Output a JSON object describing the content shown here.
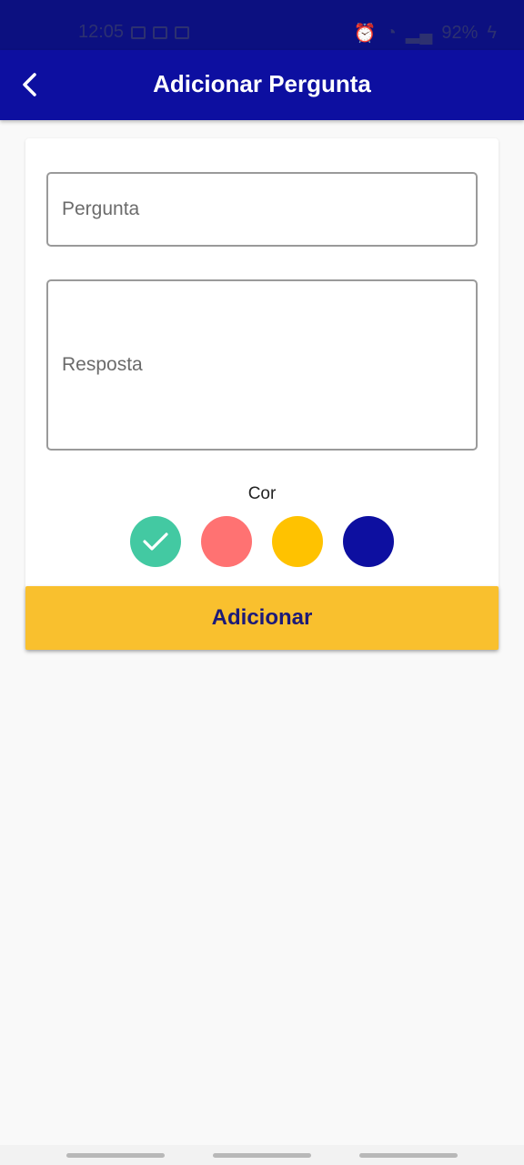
{
  "status_bar": {
    "time": "12:05",
    "battery": "92%"
  },
  "app_bar": {
    "title": "Adicionar Pergunta",
    "back_icon": "chevron-left-icon"
  },
  "form": {
    "question_placeholder": "Pergunta",
    "answer_placeholder": "Resposta",
    "color_label": "Cor",
    "colors": [
      {
        "name": "green",
        "hex": "#43c9a2",
        "selected": true
      },
      {
        "name": "red",
        "hex": "#ff7272",
        "selected": false
      },
      {
        "name": "yellow",
        "hex": "#ffc200",
        "selected": false
      },
      {
        "name": "blue",
        "hex": "#0d0fa0",
        "selected": false
      }
    ],
    "submit_label": "Adicionar"
  },
  "theme": {
    "primary": "#0d0fa0",
    "accent": "#f9c02e"
  }
}
